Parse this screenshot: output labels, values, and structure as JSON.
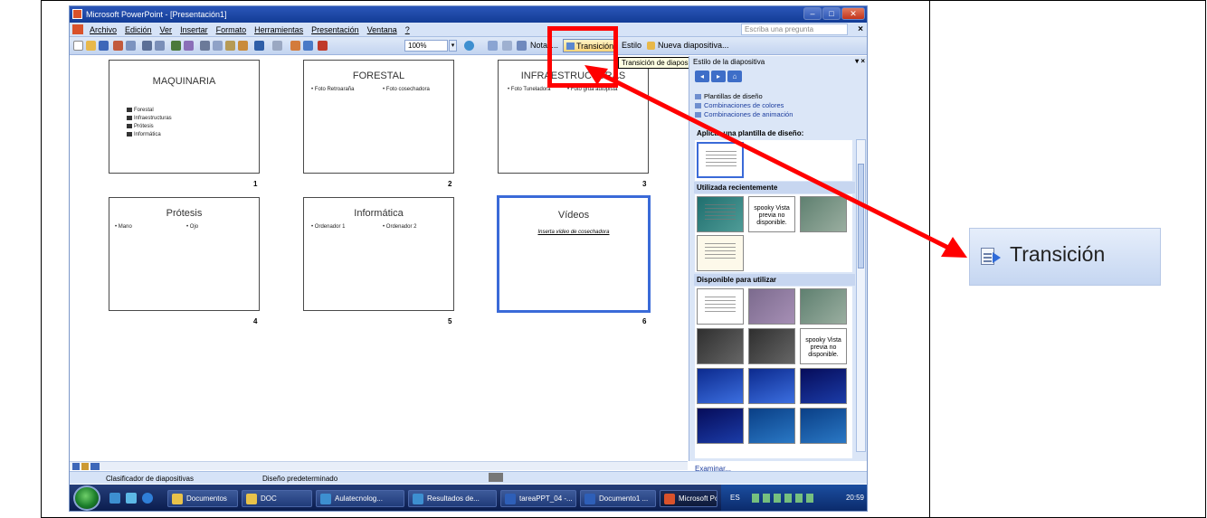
{
  "window": {
    "title": "Microsoft PowerPoint - [Presentación1]",
    "controls": [
      "–",
      "□",
      "✕"
    ]
  },
  "menu": {
    "items": [
      "Archivo",
      "Edición",
      "Ver",
      "Insertar",
      "Formato",
      "Herramientas",
      "Presentación",
      "Ventana",
      "?"
    ],
    "ask_placeholder": "Escriba una pregunta",
    "close": "×"
  },
  "toolbar": {
    "zoom": "100%",
    "notes_label": "Notas...",
    "transition_label": "Transición",
    "style_label": "Estilo",
    "new_slide_label": "Nueva diapositiva..."
  },
  "tooltip": "Transición de diapositiva",
  "slides": [
    {
      "number": "1",
      "title": "MAQUINARIA",
      "bullets": [
        "Forestal",
        "Infraestructuras",
        "Prótesis",
        "Informática"
      ]
    },
    {
      "number": "2",
      "title": "FORESTAL",
      "bullets": [
        "Foto Retroaraña",
        "Foto cosechadora"
      ]
    },
    {
      "number": "3",
      "title": "INFRAESTRUCTURAS",
      "bullets": [
        "Foto Tuneladora",
        "Foto grúa autopista"
      ]
    },
    {
      "number": "4",
      "title": "Prótesis",
      "bullets": [
        "Mano",
        "Ojo"
      ]
    },
    {
      "number": "5",
      "title": "Informática",
      "bullets": [
        "Ordenador 1",
        "Ordenador 2"
      ]
    },
    {
      "number": "6",
      "title": "Vídeos",
      "link": "Inserta vídeo de cosechadora"
    }
  ],
  "task_pane": {
    "title": "Estilo de la diapositiva",
    "links": [
      "Plantillas de diseño",
      "Combinaciones de colores",
      "Combinaciones de animación"
    ],
    "apply_heading": "Aplicar una plantilla de diseño:",
    "recent_heading": "Utilizada recientemente",
    "available_heading": "Disponible para utilizar",
    "preview_unavailable": "spooky Vista previa no disponible.",
    "browse": "Examinar..."
  },
  "status_bar": {
    "view": "Clasificador de diapositivas",
    "design": "Diseño predeterminado"
  },
  "taskbar": {
    "buttons": [
      "Documentos",
      "DOC",
      "Aulatecnolog...",
      "Resultados de...",
      "tareaPPT_04 -...",
      "Documento1 ...",
      "Microsoft Po..."
    ],
    "language": "ES",
    "clock": "20:59"
  },
  "zoomed_button": {
    "label": "Transición"
  },
  "colors": {
    "highlight_red": "#ff0000",
    "titlebar_blue": "#2b56b8",
    "selected_slide": "#3a6ad8"
  }
}
